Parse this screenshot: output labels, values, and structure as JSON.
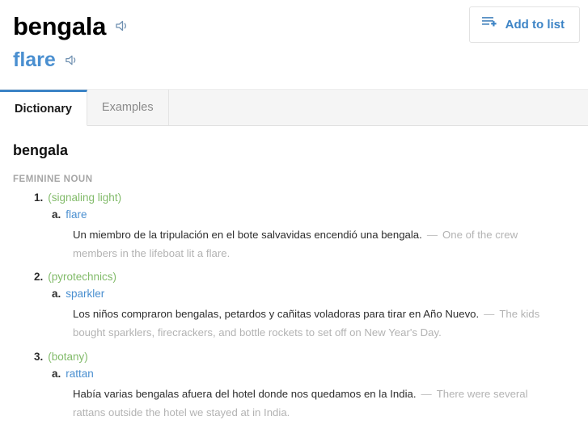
{
  "header": {
    "headword": "bengala",
    "headword_audio_icon": "speaker-icon",
    "translation": "flare",
    "translation_audio_icon": "speaker-icon",
    "add_to_list_label": "Add to list",
    "add_to_list_icon": "list-add-icon"
  },
  "tabs": [
    {
      "label": "Dictionary",
      "active": true
    },
    {
      "label": "Examples",
      "active": false
    }
  ],
  "entry": {
    "headword": "bengala",
    "part_of_speech": "FEMININE NOUN",
    "senses": [
      {
        "number": "1.",
        "context": "(signaling light)",
        "subsenses": [
          {
            "letter": "a.",
            "translation": "flare",
            "example_source": "Un miembro de la tripulación en el bote salvavidas encendió una bengala.",
            "example_dash": "—",
            "example_target": "One of the crew members in the lifeboat lit a flare."
          }
        ]
      },
      {
        "number": "2.",
        "context": "(pyrotechnics)",
        "subsenses": [
          {
            "letter": "a.",
            "translation": "sparkler",
            "example_source": "Los niños compraron bengalas, petardos y cañitas voladoras para tirar en Año Nuevo.",
            "example_dash": "—",
            "example_target": "The kids bought sparklers, firecrackers, and bottle rockets to set off on New Year's Day."
          }
        ]
      },
      {
        "number": "3.",
        "context": "(botany)",
        "subsenses": [
          {
            "letter": "a.",
            "translation": "rattan",
            "example_source": "Había varias bengalas afuera del hotel donde nos quedamos en la India.",
            "example_dash": "—",
            "example_target": "There were several rattans outside the hotel we stayed at in India."
          }
        ]
      }
    ]
  },
  "colors": {
    "accent_blue": "#4a8fd0",
    "link_blue": "#3d84c6",
    "context_green": "#82bb6a",
    "muted_gray": "#b3b3b3",
    "label_gray": "#a6a6a6"
  }
}
